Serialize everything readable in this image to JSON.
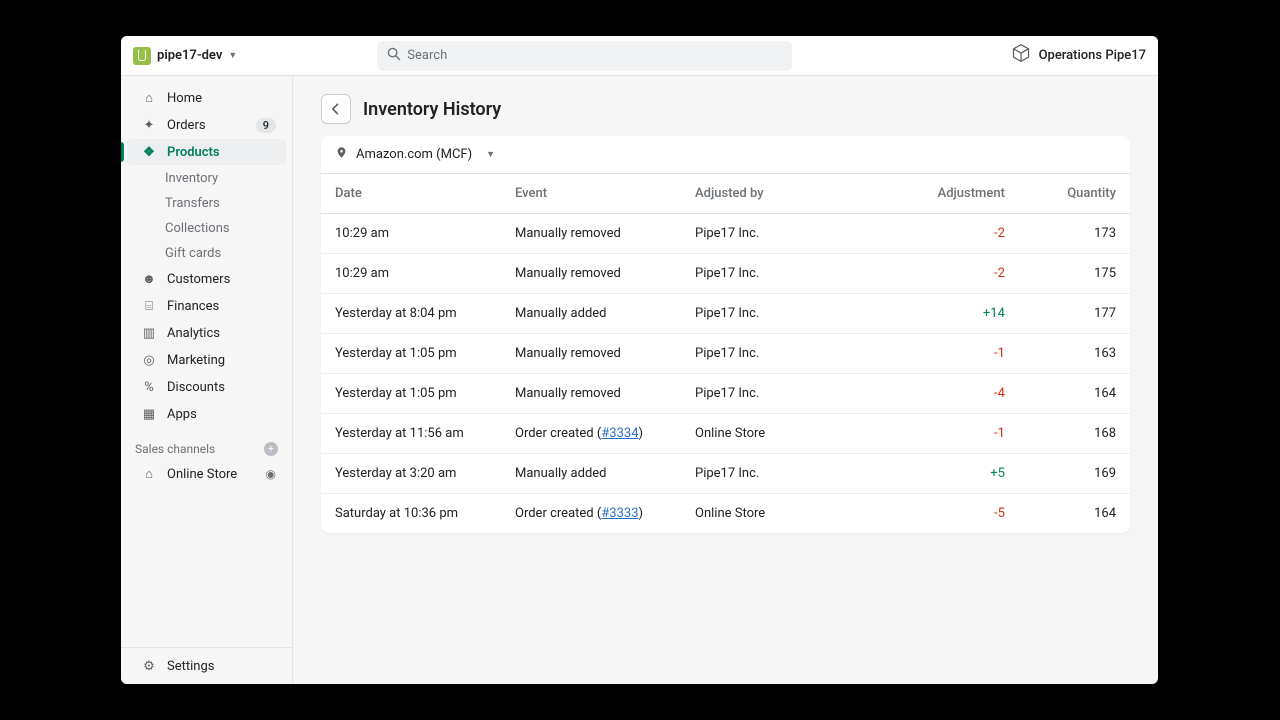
{
  "header": {
    "store_name": "pipe17-dev",
    "search_placeholder": "Search",
    "account_label": "Operations Pipe17"
  },
  "sidebar": {
    "items": [
      {
        "key": "home",
        "label": "Home",
        "icon": "⌂"
      },
      {
        "key": "orders",
        "label": "Orders",
        "icon": "✦",
        "badge": "9"
      },
      {
        "key": "products",
        "label": "Products",
        "icon": "❖",
        "active": true,
        "sub": [
          {
            "key": "inventory",
            "label": "Inventory"
          },
          {
            "key": "transfers",
            "label": "Transfers"
          },
          {
            "key": "collections",
            "label": "Collections"
          },
          {
            "key": "giftcards",
            "label": "Gift cards"
          }
        ]
      },
      {
        "key": "customers",
        "label": "Customers",
        "icon": "☻"
      },
      {
        "key": "finances",
        "label": "Finances",
        "icon": "⌸"
      },
      {
        "key": "analytics",
        "label": "Analytics",
        "icon": "▥"
      },
      {
        "key": "marketing",
        "label": "Marketing",
        "icon": "◎"
      },
      {
        "key": "discounts",
        "label": "Discounts",
        "icon": "%"
      },
      {
        "key": "apps",
        "label": "Apps",
        "icon": "▦"
      }
    ],
    "channels_label": "Sales channels",
    "channels": [
      {
        "key": "onlinestore",
        "label": "Online Store",
        "icon": "⌂"
      }
    ],
    "settings_label": "Settings"
  },
  "page": {
    "title": "Inventory History",
    "location": "Amazon.com (MCF)",
    "columns": {
      "date": "Date",
      "event": "Event",
      "adjusted_by": "Adjusted by",
      "adjustment": "Adjustment",
      "quantity": "Quantity"
    },
    "rows": [
      {
        "date": "10:29 am",
        "event": "Manually removed",
        "adjusted_by": "Pipe17 Inc.",
        "adjustment": "-2",
        "adj_sign": "neg",
        "quantity": "173"
      },
      {
        "date": "10:29 am",
        "event": "Manually removed",
        "adjusted_by": "Pipe17 Inc.",
        "adjustment": "-2",
        "adj_sign": "neg",
        "quantity": "175"
      },
      {
        "date": "Yesterday at 8:04 pm",
        "event": "Manually added",
        "adjusted_by": "Pipe17 Inc.",
        "adjustment": "+14",
        "adj_sign": "pos",
        "quantity": "177"
      },
      {
        "date": "Yesterday at 1:05 pm",
        "event": "Manually removed",
        "adjusted_by": "Pipe17 Inc.",
        "adjustment": "-1",
        "adj_sign": "neg",
        "quantity": "163"
      },
      {
        "date": "Yesterday at 1:05 pm",
        "event": "Manually removed",
        "adjusted_by": "Pipe17 Inc.",
        "adjustment": "-4",
        "adj_sign": "neg",
        "quantity": "164"
      },
      {
        "date": "Yesterday at 11:56 am",
        "event_prefix": "Order created (",
        "order_link": "#3334",
        "event_suffix": ")",
        "adjusted_by": "Online Store",
        "adjustment": "-1",
        "adj_sign": "neg",
        "quantity": "168"
      },
      {
        "date": "Yesterday at 3:20 am",
        "event": "Manually added",
        "adjusted_by": "Pipe17 Inc.",
        "adjustment": "+5",
        "adj_sign": "pos",
        "quantity": "169"
      },
      {
        "date": "Saturday at 10:36 pm",
        "event_prefix": "Order created (",
        "order_link": "#3333",
        "event_suffix": ")",
        "adjusted_by": "Online Store",
        "adjustment": "-5",
        "adj_sign": "neg",
        "quantity": "164"
      }
    ]
  }
}
